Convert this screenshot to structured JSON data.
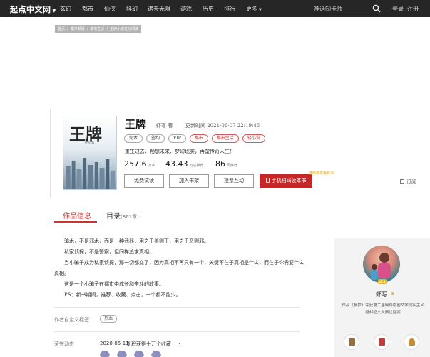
{
  "nav": {
    "logo": "起点中文网",
    "items": [
      "玄幻",
      "都市",
      "仙侠",
      "科幻",
      "诸天无限",
      "游戏",
      "历史",
      "排行",
      "更多"
    ],
    "search_value": "神话制卡师",
    "login": "登录",
    "register": "注册"
  },
  "breadcrumb": [
    "首页",
    "都市频道",
    "都市生活",
    "王牌小说在线阅读"
  ],
  "book": {
    "cover_title": "王牌",
    "cover_author": "虾写 著",
    "title": "王牌",
    "author": "虾写 著",
    "updated": "更新时间 2021-06-07 22:19:45",
    "tags": [
      {
        "label": "完本",
        "style": "gray"
      },
      {
        "label": "签约",
        "style": "gray"
      },
      {
        "label": "VIP",
        "style": "gray"
      },
      {
        "label": "都市",
        "style": "red"
      },
      {
        "label": "都市生活",
        "style": "red"
      },
      {
        "label": "轻小说",
        "style": "red"
      }
    ],
    "intro": "重生过去、畅想未来、梦幻现实，再塑传奇人生！",
    "stats": [
      {
        "num": "257.6",
        "unit": "万字"
      },
      {
        "num": "43.43",
        "unit": "万总推荐"
      },
      {
        "num": "86",
        "unit": "周推荐"
      }
    ],
    "buttons": {
      "free_read": "免费试读",
      "add_shelf": "加入书架",
      "vote": "投票互动",
      "scan": "手机扫码读本书",
      "promo": "送你多本免费书",
      "subscribe": "订阅"
    }
  },
  "tabs": {
    "info": "作品信息",
    "catalog": "目录",
    "catalog_count": "(861章)"
  },
  "description": [
    "骗术，不是邪术，而是一种武器，用之于善则正，用之于恶则邪。",
    "私家侦探，不是警察，但同样追求真相。",
    "当小骗子成为私家侦探，那一切都变了，因为真相不再只有一个，关键不在于真相是什么，而在于你需要什么",
    "真相。",
    "这是一个小骗子在都市中成长和奋斗的故事。",
    "PS：新书期间，推荐、收藏、点击，一个都不能少。"
  ],
  "author_tags": {
    "label": "作者自定义标签",
    "tag": "热血"
  },
  "honor": {
    "label": "荣誉动态",
    "date": "2020-05-11",
    "text": "累积获得十万个收藏"
  },
  "sidebar": {
    "level": "LV.8",
    "name": "虾写",
    "award": "作品《畅梦》荣获第二届网络原创文学现实主义题材征文大赛优胜奖"
  },
  "colors": {
    "accent_red": "#c62828",
    "nav_bg": "#262626",
    "promo": "#e8a000"
  }
}
